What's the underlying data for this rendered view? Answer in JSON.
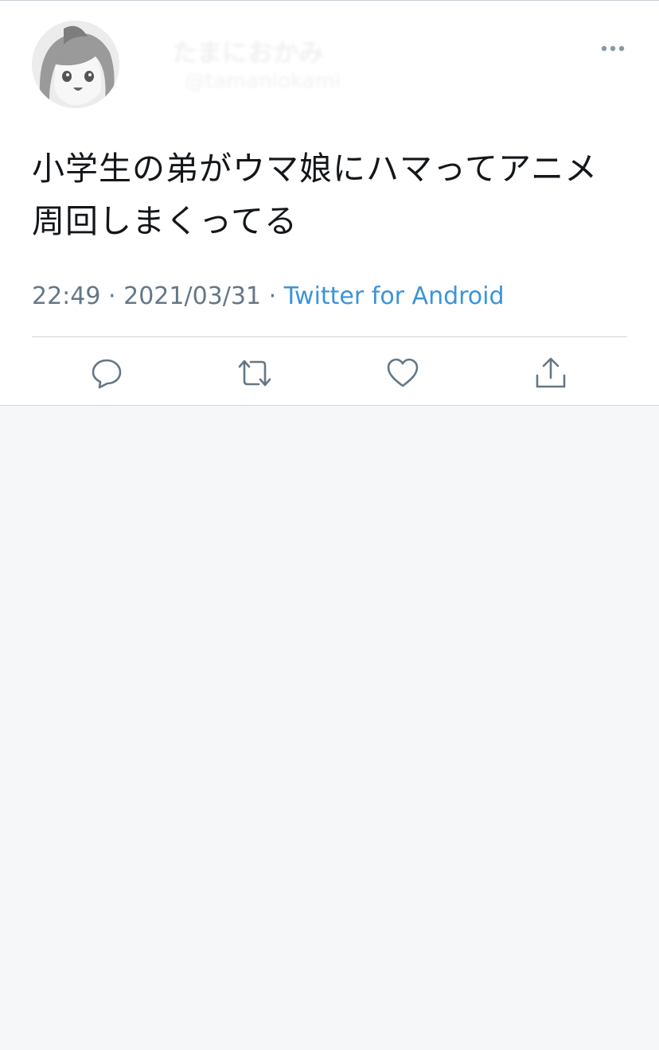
{
  "tweet": {
    "author": {
      "display_name": "たまにおかみ",
      "handle": "@tamaniokami"
    },
    "text_lines": [
      "小学生の弟がウマ娘にハマってアニメ",
      "周回しまくってる"
    ],
    "time": "22:49",
    "date": "2021/03/31",
    "separator": "·",
    "source": "Twitter for Android"
  },
  "icons": {
    "more": "more-horizontal-icon",
    "reply": "reply-bubble-icon",
    "retweet": "retweet-arrows-icon",
    "like": "heart-icon",
    "share": "share-upload-icon"
  },
  "colors": {
    "text": "#14171a",
    "muted": "#657786",
    "link": "#3b94d9",
    "icon": "#657786",
    "background": "#f5f7f9"
  }
}
